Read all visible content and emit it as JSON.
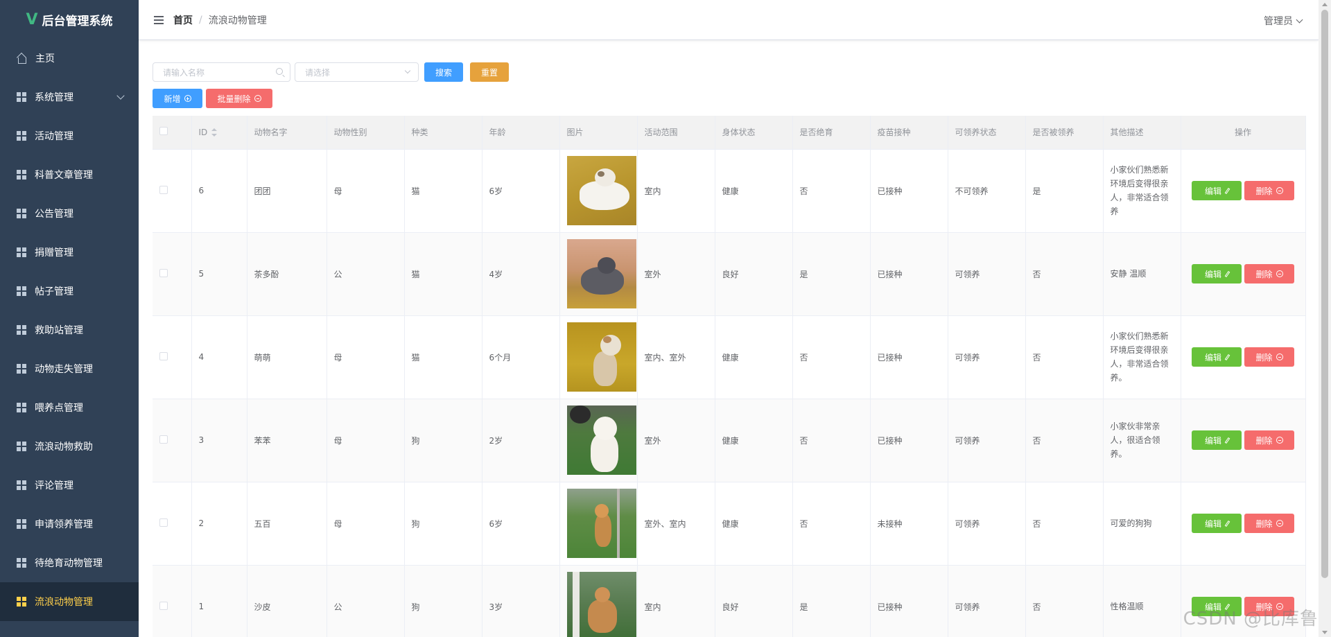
{
  "app": {
    "logo_letter": "V",
    "title": "后台管理系统"
  },
  "sidebar": {
    "items": [
      {
        "label": "主页"
      },
      {
        "label": "系统管理"
      },
      {
        "label": "活动管理"
      },
      {
        "label": "科普文章管理"
      },
      {
        "label": "公告管理"
      },
      {
        "label": "捐赠管理"
      },
      {
        "label": "帖子管理"
      },
      {
        "label": "救助站管理"
      },
      {
        "label": "动物走失管理"
      },
      {
        "label": "喂养点管理"
      },
      {
        "label": "流浪动物救助"
      },
      {
        "label": "评论管理"
      },
      {
        "label": "申请领养管理"
      },
      {
        "label": "待绝育动物管理"
      },
      {
        "label": "流浪动物管理"
      }
    ],
    "active_index": 14,
    "active_color": "#ffd04b"
  },
  "header": {
    "breadcrumb_home": "首页",
    "breadcrumb_sep": "/",
    "breadcrumb_current": "流浪动物管理",
    "user": "管理员"
  },
  "toolbar": {
    "name_placeholder": "请输入名称",
    "select_placeholder": "请选择",
    "search_label": "搜索",
    "reset_label": "重置",
    "add_label": "新增",
    "batch_delete_label": "批量删除"
  },
  "table": {
    "headers": {
      "id": "ID",
      "name": "动物名字",
      "gender": "动物性别",
      "species": "种类",
      "age": "年龄",
      "photo": "图片",
      "range": "活动范围",
      "health": "身体状态",
      "sterilized": "是否绝育",
      "vaccine": "疫苗接种",
      "adopt_status": "可领养状态",
      "adopted": "是否被领养",
      "desc": "其他描述",
      "ops": "操作"
    },
    "edit_label": "编辑",
    "delete_label": "删除",
    "rows": [
      {
        "id": "6",
        "name": "团团",
        "gender": "母",
        "species": "猫",
        "age": "6岁",
        "range": "室内",
        "health": "健康",
        "sterilized": "否",
        "vaccine": "已接种",
        "adopt_status": "不可领养",
        "adopted": "是",
        "desc": "小家伙们熟悉新环境后变得很亲人，非常适合领养"
      },
      {
        "id": "5",
        "name": "茶多酚",
        "gender": "公",
        "species": "猫",
        "age": "4岁",
        "range": "室外",
        "health": "良好",
        "sterilized": "是",
        "vaccine": "已接种",
        "adopt_status": "可领养",
        "adopted": "否",
        "desc": "安静 温顺"
      },
      {
        "id": "4",
        "name": "萌萌",
        "gender": "母",
        "species": "猫",
        "age": "6个月",
        "range": "室内、室外",
        "health": "健康",
        "sterilized": "否",
        "vaccine": "已接种",
        "adopt_status": "可领养",
        "adopted": "否",
        "desc": "小家伙们熟悉新环境后变得很亲人，非常适合领养。"
      },
      {
        "id": "3",
        "name": "苯苯",
        "gender": "母",
        "species": "狗",
        "age": "2岁",
        "range": "室外",
        "health": "健康",
        "sterilized": "否",
        "vaccine": "已接种",
        "adopt_status": "可领养",
        "adopted": "否",
        "desc": "小家伙非常亲人，很适合领养。"
      },
      {
        "id": "2",
        "name": "五百",
        "gender": "母",
        "species": "狗",
        "age": "6岁",
        "range": "室外、室内",
        "health": "健康",
        "sterilized": "否",
        "vaccine": "未接种",
        "adopt_status": "可领养",
        "adopted": "否",
        "desc": "可爱的狗狗"
      },
      {
        "id": "1",
        "name": "沙皮",
        "gender": "公",
        "species": "狗",
        "age": "3岁",
        "range": "室内",
        "health": "良好",
        "sterilized": "是",
        "vaccine": "已接种",
        "adopt_status": "可领养",
        "adopted": "否",
        "desc": "性格温顺"
      }
    ]
  },
  "watermark": "CSDN @比库鲁"
}
